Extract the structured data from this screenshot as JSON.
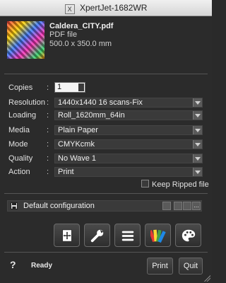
{
  "window": {
    "title": "XpertJet-1682WR",
    "logo_glyph": "X"
  },
  "file": {
    "name": "Caldera_CITY.pdf",
    "type": "PDF file",
    "size": "500.0 x 350.0 mm"
  },
  "form": {
    "copies": {
      "label": "Copies",
      "value": "1"
    },
    "resolution": {
      "label": "Resolution",
      "value": "1440x1440 16 scans-Fix"
    },
    "loading": {
      "label": "Loading",
      "value": "Roll_1620mm_64in"
    },
    "media": {
      "label": "Media",
      "value": "Plain Paper"
    },
    "mode": {
      "label": "Mode",
      "value": "CMYKcmk"
    },
    "quality": {
      "label": "Quality",
      "value": "No Wave 1"
    },
    "action": {
      "label": "Action",
      "value": "Print"
    },
    "colon": ":"
  },
  "options": {
    "keep_ripped": "Keep Ripped file"
  },
  "configuration": {
    "value": "Default configuration",
    "more": "..."
  },
  "toolbar": {
    "icons": [
      "layout-icon",
      "wrench-icon",
      "list-icon",
      "color-swatch-icon",
      "palette-icon"
    ]
  },
  "footer": {
    "help": "?",
    "status": "Ready",
    "print": "Print",
    "quit": "Quit"
  },
  "colors": {
    "window_bg": "#2b2b2b",
    "field_bg": "#3a3a3a",
    "text": "#e6e6e6"
  }
}
